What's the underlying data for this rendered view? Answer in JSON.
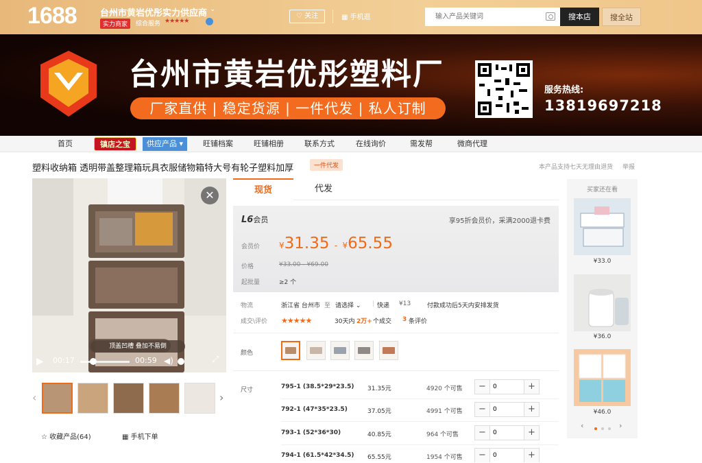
{
  "header": {
    "logo": "1688",
    "shop_name": "台州市黄岩优彤实力供应商",
    "badge": "实力商家",
    "service_label": "综合服务",
    "service_stars": "★★★★★",
    "follow": "关注",
    "mobile_shop": "手机逛",
    "search_placeholder": "输入产品关键词",
    "search_this": "搜本店",
    "search_all": "搜全站"
  },
  "banner": {
    "title": "台州市黄岩优彤塑料厂",
    "slogan": "厂家直供 | 稳定货源 | 一件代发 | 私人订制",
    "hotline_label": "服务热线:",
    "hotline": "13819697218"
  },
  "nav": {
    "home": "首页",
    "hot": "镇店之宝",
    "supply": "供应产品 ▾",
    "archive": "旺铺档案",
    "album": "旺铺相册",
    "contact": "联系方式",
    "inquiry": "在线询价",
    "dropship": "需发帮",
    "micro": "微商代理"
  },
  "product": {
    "title": "塑料收纳箱 透明带盖整理箱玩具衣服储物箱特大号有轮子塑料加厚",
    "tag": "一件代发",
    "return_note": "本产品支持七天无理由退货",
    "report": "举报",
    "video_current": "00:17",
    "video_total": "00:59",
    "image_caption": "顶盖凹槽 叠加不易倒",
    "favorite": "收藏产品(64)",
    "mobile_order": "手机下单"
  },
  "tabs": {
    "spot": "现货",
    "agent": "代发"
  },
  "pricing": {
    "level": "L6",
    "level_suffix": "会员",
    "member_note": "享95折会员价，采满2000退卡费",
    "member_price_label": "会员价",
    "member_price_low": "31.35",
    "member_price_high": "65.55",
    "currency": "¥",
    "price_label": "价格",
    "price_original": "¥33.00 - ¥69.00",
    "moq_label": "起批量",
    "moq": "≥2 个"
  },
  "shipping": {
    "label": "物流",
    "from": "浙江省 台州市",
    "to_word": "至",
    "dest": "请选择",
    "express": "快递",
    "fee": "¥13",
    "note": "付款成功后5天内安排发货",
    "reviews_label": "成交\\评价",
    "stars": "★★★★★",
    "sales_prefix": "30天内",
    "sales_count": "2万+",
    "sales_suffix": "个成交",
    "review_count": "3",
    "review_suffix": "条评价"
  },
  "color_label": "颜色",
  "size_label": "尺寸",
  "sizes": [
    {
      "name": "795-1 (38.5*29*23.5)",
      "price": "31.35元",
      "stock": "4920 个可售",
      "qty": "0"
    },
    {
      "name": "792-1 (47*35*23.5)",
      "price": "37.05元",
      "stock": "4991 个可售",
      "qty": "0"
    },
    {
      "name": "793-1 (52*36*30)",
      "price": "40.85元",
      "stock": "964 个可售",
      "qty": "0"
    },
    {
      "name": "794-1 (61.5*42*34.5)",
      "price": "65.55元",
      "stock": "1954 个可售",
      "qty": "0"
    }
  ],
  "recommend": {
    "title": "买家还在看",
    "items": [
      {
        "price": "¥33.0"
      },
      {
        "price": "¥36.0"
      },
      {
        "price": "¥46.0"
      }
    ]
  },
  "colors": {
    "accent": "#f06a18",
    "header": "#f2cf97",
    "nav_hot": "#c3141f",
    "nav_supply": "#4a8fd8"
  }
}
